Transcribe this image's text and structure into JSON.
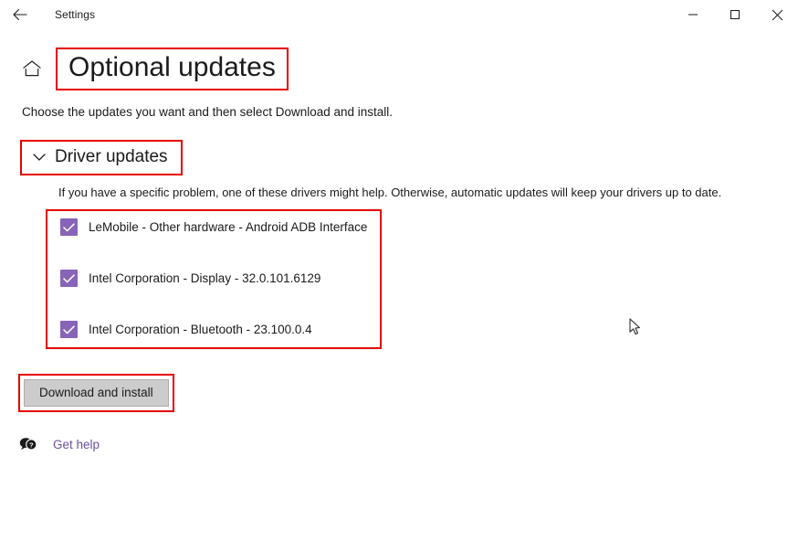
{
  "window": {
    "app_title": "Settings",
    "back_icon": "back-arrow-icon",
    "minimize_label": "—",
    "maximize_label": "☐",
    "close_label": "✕"
  },
  "page": {
    "home_icon": "home-icon",
    "title": "Optional updates",
    "subtitle": "Choose the updates you want and then select Download and install."
  },
  "section": {
    "chevron_icon": "chevron-down-icon",
    "heading": "Driver updates",
    "description": "If you have a specific problem, one of these drivers might help. Otherwise, automatic updates will keep your drivers up to date."
  },
  "updates": [
    {
      "label": "LeMobile - Other hardware - Android ADB Interface",
      "checked": true
    },
    {
      "label": "Intel Corporation - Display - 32.0.101.6129",
      "checked": true
    },
    {
      "label": "Intel Corporation - Bluetooth - 23.100.0.4",
      "checked": true
    }
  ],
  "actions": {
    "download_install_label": "Download and install"
  },
  "help": {
    "icon": "question-bubble-icon",
    "label": "Get help"
  },
  "colors": {
    "accent_purple": "#8764b8",
    "annotation_red": "#e60000",
    "link_purple": "#6b4f9e",
    "button_gray": "#cccccc"
  }
}
